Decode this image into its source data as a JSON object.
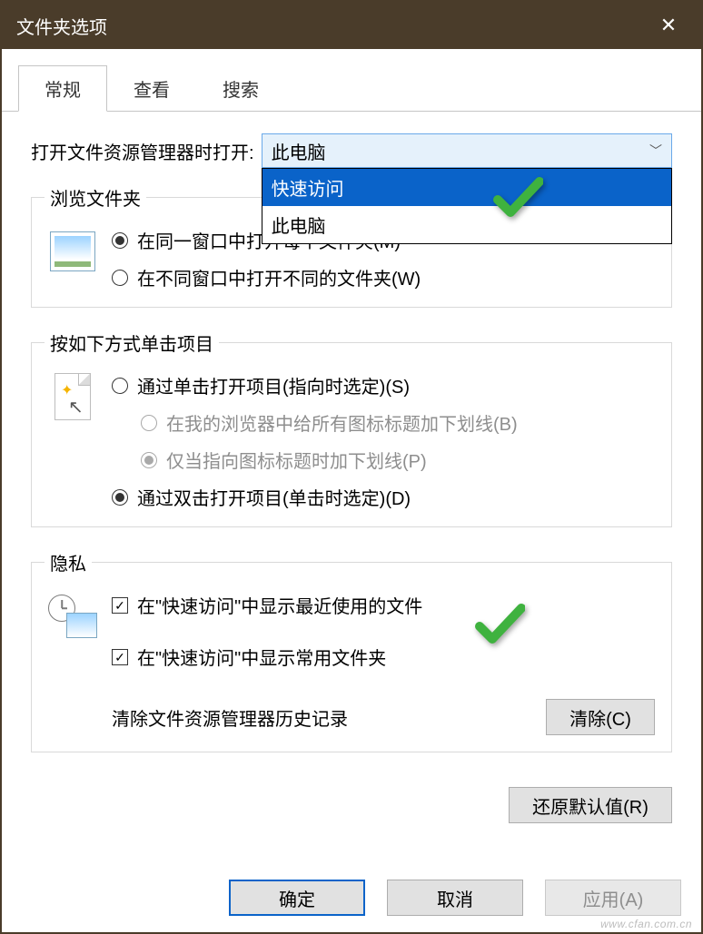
{
  "window": {
    "title": "文件夹选项"
  },
  "tabs": {
    "general": "常规",
    "view": "查看",
    "search": "搜索"
  },
  "openWith": {
    "label": "打开文件资源管理器时打开:",
    "selected": "此电脑",
    "options": [
      "快速访问",
      "此电脑"
    ]
  },
  "browse": {
    "legend": "浏览文件夹",
    "sameWindow": "在同一窗口中打开每个文件夹(M)",
    "ownWindow": "在不同窗口中打开不同的文件夹(W)"
  },
  "click": {
    "legend": "按如下方式单击项目",
    "singleClick": "通过单击打开项目(指向时选定)(S)",
    "underlineAll": "在我的浏览器中给所有图标标题加下划线(B)",
    "underlinePoint": "仅当指向图标标题时加下划线(P)",
    "doubleClick": "通过双击打开项目(单击时选定)(D)"
  },
  "privacy": {
    "legend": "隐私",
    "recentFiles": "在\"快速访问\"中显示最近使用的文件",
    "freqFolders": "在\"快速访问\"中显示常用文件夹",
    "clearLabel": "清除文件资源管理器历史记录",
    "clearBtn": "清除(C)"
  },
  "buttons": {
    "restore": "还原默认值(R)",
    "ok": "确定",
    "cancel": "取消",
    "apply": "应用(A)"
  },
  "watermark": "www.cfan.com.cn"
}
